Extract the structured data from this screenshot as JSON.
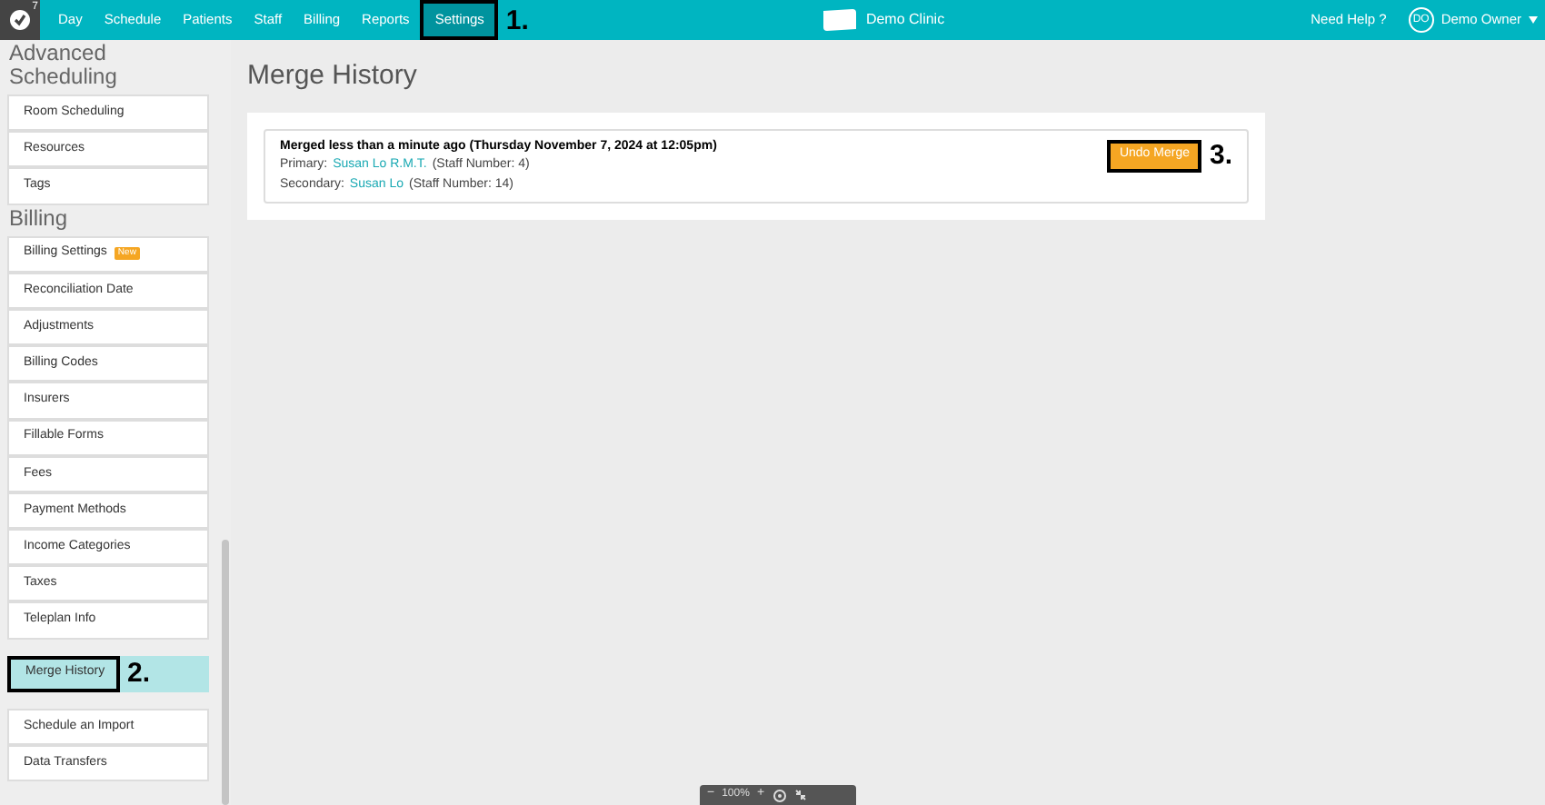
{
  "nav": {
    "badge": "7",
    "items": [
      {
        "label": "Day",
        "selected": false
      },
      {
        "label": "Schedule",
        "selected": false
      },
      {
        "label": "Patients",
        "selected": false
      },
      {
        "label": "Staff",
        "selected": false
      },
      {
        "label": "Billing",
        "selected": false
      },
      {
        "label": "Reports",
        "selected": false
      },
      {
        "label": "Settings",
        "selected": true,
        "callout": "1."
      }
    ],
    "clinic": "Demo Clinic",
    "help": "Need Help ?",
    "user": {
      "initials": "DO",
      "name": "Demo Owner"
    }
  },
  "sidebar": {
    "groups": [
      {
        "heading": "Advanced Scheduling",
        "items": [
          {
            "label": "Room Scheduling",
            "selected": false
          },
          {
            "label": "Resources",
            "selected": false
          },
          {
            "label": "Tags",
            "selected": false
          }
        ]
      },
      {
        "heading": "Billing",
        "items": [
          {
            "label": "Billing Settings",
            "badge": "New",
            "selected": false
          },
          {
            "label": "Reconciliation Date",
            "selected": false
          },
          {
            "label": "Adjustments",
            "selected": false
          },
          {
            "label": "Billing Codes",
            "selected": false
          },
          {
            "label": "Insurers",
            "selected": false
          },
          {
            "label": "Fillable Forms",
            "selected": false
          },
          {
            "label": "Fees",
            "selected": false
          },
          {
            "label": "Payment Methods",
            "selected": false
          },
          {
            "label": "Income Categories",
            "selected": false
          },
          {
            "label": "Taxes",
            "selected": false
          },
          {
            "label": "Teleplan Info",
            "selected": false
          }
        ]
      },
      {
        "items": [
          {
            "label": "Merge History",
            "selected": true,
            "callout": "2."
          }
        ]
      },
      {
        "items": [
          {
            "label": "Schedule an Import",
            "selected": false
          },
          {
            "label": "Data Transfers",
            "selected": false
          }
        ]
      }
    ]
  },
  "main": {
    "title": "Merge History",
    "merges": [
      {
        "summary": "Merged less than a minute ago (Thursday November 7, 2024 at 12:05pm)",
        "primary_label": "Primary:",
        "primary_name": "Susan Lo R.M.T.",
        "primary_number": "(Staff Number: 4)",
        "secondary_label": "Secondary:",
        "secondary_name": "Susan Lo",
        "secondary_number": "(Staff Number: 14)",
        "button": "Undo Merge",
        "callout": "3."
      }
    ]
  },
  "zoom_bar": {
    "minus": "−",
    "level": "100%",
    "plus": "+"
  }
}
